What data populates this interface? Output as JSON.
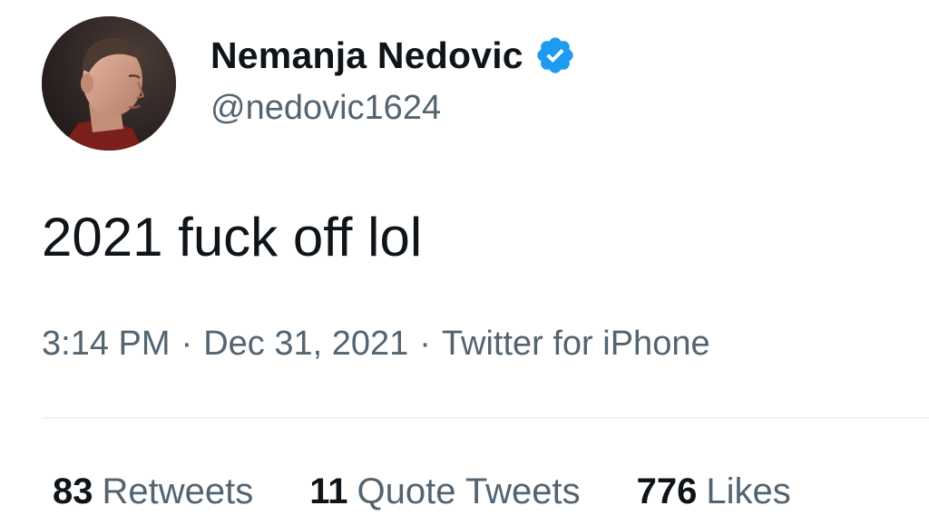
{
  "user": {
    "display_name": "Nemanja Nedovic",
    "handle": "@nedovic1624",
    "verified": true,
    "avatar_icon": "profile-photo",
    "verified_icon": "verified-badge-icon"
  },
  "tweet": {
    "text": "2021 fuck off lol",
    "time": "3:14 PM",
    "date": "Dec 31, 2021",
    "source": "Twitter for iPhone",
    "separator": "·"
  },
  "stats": [
    {
      "count": "83",
      "label": "Retweets"
    },
    {
      "count": "11",
      "label": "Quote Tweets"
    },
    {
      "count": "776",
      "label": "Likes"
    }
  ],
  "colors": {
    "text_primary": "#0f1419",
    "text_secondary": "#536471",
    "verified_blue": "#1d9bf0",
    "divider": "#eff3f4"
  }
}
